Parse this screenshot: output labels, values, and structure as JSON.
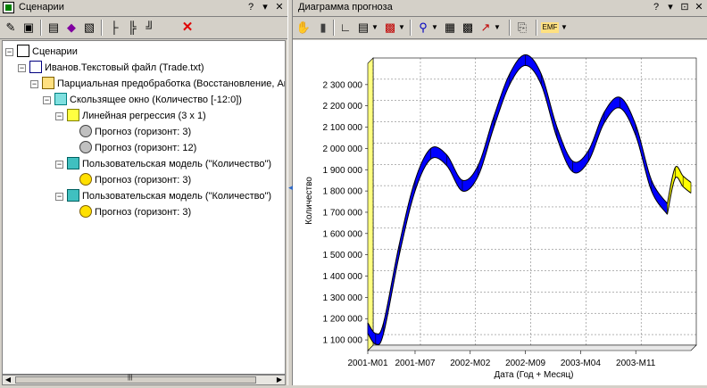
{
  "left_panel": {
    "title": "Сценарии",
    "title_buttons": {
      "help": "?",
      "menu": "▾",
      "close": "✕"
    },
    "tree": [
      {
        "label": "Сценарии",
        "icon": "scenarios-icon"
      },
      {
        "label": "Иванов.Текстовый файл (Trade.txt)",
        "icon": "text-file-icon"
      },
      {
        "label": "Парциальная предобработка (Восстановление, Ан",
        "icon": "preprocessing-icon"
      },
      {
        "label": "Скользящее окно (Количество [-12:0])",
        "icon": "sliding-window-icon"
      },
      {
        "label": "Линейная регрессия (3 x 1)",
        "icon": "linear-regression-icon"
      },
      {
        "label": "Прогноз (горизонт: 3)",
        "icon": "forecast-icon"
      },
      {
        "label": "Прогноз (горизонт: 12)",
        "icon": "forecast-icon"
      },
      {
        "label": "Пользовательская модель (\"Количество\")",
        "icon": "custom-model-icon"
      },
      {
        "label": "Прогноз (горизонт: 3)",
        "icon": "forecast-icon"
      },
      {
        "label": "Пользовательская модель (\"Количество\")",
        "icon": "custom-model-icon"
      },
      {
        "label": "Прогноз (горизонт: 3)",
        "icon": "forecast-icon"
      }
    ],
    "scrollbar": {
      "grip": "|||"
    }
  },
  "right_panel": {
    "title": "Диаграмма прогноза",
    "title_buttons": {
      "help": "?",
      "menu": "▾",
      "float": "⊡",
      "close": "✕"
    }
  },
  "chart_data": {
    "type": "area",
    "style": "3d-ribbon",
    "xlabel": "Дата (Год + Месяц)",
    "ylabel": "Количество",
    "x_ticks": [
      "2001-M01",
      "2001-M07",
      "2002-M02",
      "2002-M09",
      "2003-M04",
      "2003-M11"
    ],
    "y_ticks": [
      "1 100 000",
      "1 200 000",
      "1 300 000",
      "1 400 000",
      "1 500 000",
      "1 600 000",
      "1 700 000",
      "1 800 000",
      "1 900 000",
      "2 000 000",
      "2 100 000",
      "2 200 000",
      "2 300 000"
    ],
    "ylim": [
      1050000,
      2400000
    ],
    "grid": true,
    "series": [
      {
        "color": "#0000ff",
        "points": [
          [
            "2001-M01",
            1130000
          ],
          [
            "2001-M02",
            1080000
          ],
          [
            "2001-M03",
            1130000
          ],
          [
            "2001-M05",
            1500000
          ],
          [
            "2001-M07",
            1800000
          ],
          [
            "2001-M09",
            1950000
          ],
          [
            "2001-M11",
            1920000
          ],
          [
            "2002-M01",
            1800000
          ],
          [
            "2002-M03",
            1870000
          ],
          [
            "2002-M05",
            2100000
          ],
          [
            "2002-M07",
            2300000
          ],
          [
            "2002-M09",
            2390000
          ],
          [
            "2002-M11",
            2300000
          ],
          [
            "2003-M01",
            2050000
          ],
          [
            "2003-M03",
            1890000
          ],
          [
            "2003-M05",
            1940000
          ],
          [
            "2003-M07",
            2120000
          ],
          [
            "2003-M09",
            2190000
          ],
          [
            "2003-M11",
            2060000
          ],
          [
            "2004-M01",
            1800000
          ],
          [
            "2004-M03",
            1690000
          ]
        ]
      },
      {
        "color": "#ffff00",
        "points": [
          [
            "2004-M03",
            1690000
          ],
          [
            "2004-M04",
            1860000
          ],
          [
            "2004-M05",
            1820000
          ],
          [
            "2004-M06",
            1790000
          ]
        ]
      }
    ]
  }
}
